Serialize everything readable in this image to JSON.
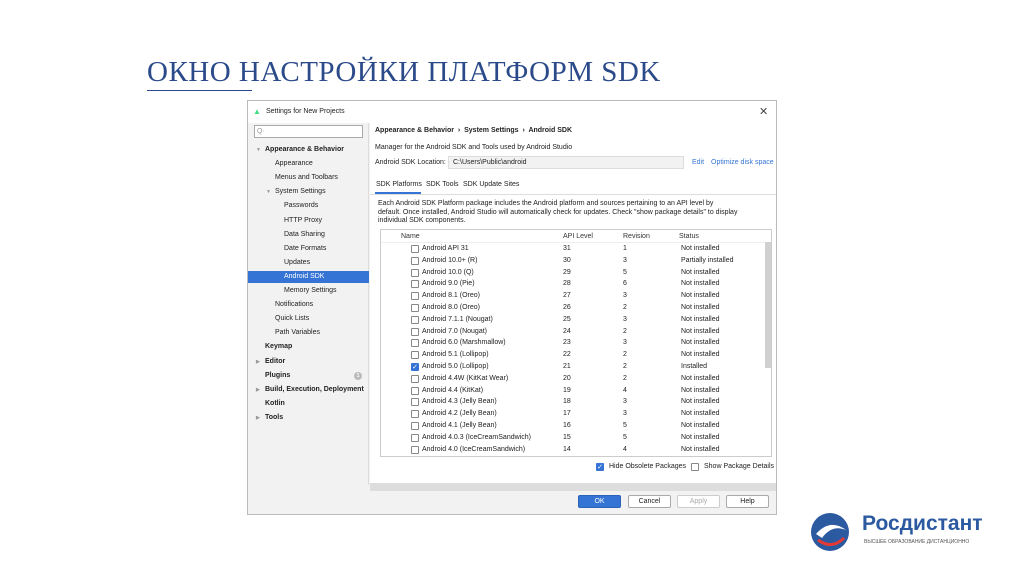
{
  "slide": {
    "title": "ОКНО НАСТРОЙКИ ПЛАТФОРМ SDK"
  },
  "dialog": {
    "title": "Settings for New Projects",
    "search_placeholder": "Q·",
    "sidebar": [
      {
        "label": "Appearance & Behavior",
        "level": 0,
        "bold": true,
        "arrow": "▼"
      },
      {
        "label": "Appearance",
        "level": 1
      },
      {
        "label": "Menus and Toolbars",
        "level": 1
      },
      {
        "label": "System Settings",
        "level": 1,
        "arrow": "▼"
      },
      {
        "label": "Passwords",
        "level": 2
      },
      {
        "label": "HTTP Proxy",
        "level": 2
      },
      {
        "label": "Data Sharing",
        "level": 2
      },
      {
        "label": "Date Formats",
        "level": 2
      },
      {
        "label": "Updates",
        "level": 2
      },
      {
        "label": "Android SDK",
        "level": 2,
        "selected": true
      },
      {
        "label": "Memory Settings",
        "level": 2
      },
      {
        "label": "Notifications",
        "level": 1
      },
      {
        "label": "Quick Lists",
        "level": 1
      },
      {
        "label": "Path Variables",
        "level": 1
      },
      {
        "label": "Keymap",
        "level": 0,
        "bold": true
      },
      {
        "label": "Editor",
        "level": 0,
        "bold": true,
        "arrow": "▶"
      },
      {
        "label": "Plugins",
        "level": 0,
        "bold": true,
        "badge": "1"
      },
      {
        "label": "Build, Execution, Deployment",
        "level": 0,
        "bold": true,
        "arrow": "▶"
      },
      {
        "label": "Kotlin",
        "level": 0,
        "bold": true
      },
      {
        "label": "Tools",
        "level": 0,
        "bold": true,
        "arrow": "▶"
      }
    ],
    "breadcrumb": [
      "Appearance & Behavior",
      "System Settings",
      "Android SDK"
    ],
    "breadcrumb_sep": "›",
    "description": "Manager for the Android SDK and Tools used by Android Studio",
    "location_label": "Android SDK Location:",
    "location_value": "C:\\Users\\Public\\android",
    "edit_link": "Edit",
    "optimize_link": "Optimize disk space",
    "tabs": [
      "SDK Platforms",
      "SDK Tools",
      "SDK Update Sites"
    ],
    "tab_info": "Each Android SDK Platform package includes the Android platform and sources pertaining to an API level by default. Once installed, Android Studio will automatically check for updates. Check \"show package details\" to display individual SDK components.",
    "columns": [
      "Name",
      "API Level",
      "Revision",
      "Status"
    ],
    "rows": [
      {
        "name": "Android API 31",
        "api": "31",
        "rev": "1",
        "status": "Not installed",
        "checked": false
      },
      {
        "name": "Android 10.0+ (R)",
        "api": "30",
        "rev": "3",
        "status": "Partially installed",
        "checked": false
      },
      {
        "name": "Android 10.0 (Q)",
        "api": "29",
        "rev": "5",
        "status": "Not installed",
        "checked": false
      },
      {
        "name": "Android 9.0 (Pie)",
        "api": "28",
        "rev": "6",
        "status": "Not installed",
        "checked": false
      },
      {
        "name": "Android 8.1 (Oreo)",
        "api": "27",
        "rev": "3",
        "status": "Not installed",
        "checked": false
      },
      {
        "name": "Android 8.0 (Oreo)",
        "api": "26",
        "rev": "2",
        "status": "Not installed",
        "checked": false
      },
      {
        "name": "Android 7.1.1 (Nougat)",
        "api": "25",
        "rev": "3",
        "status": "Not installed",
        "checked": false
      },
      {
        "name": "Android 7.0 (Nougat)",
        "api": "24",
        "rev": "2",
        "status": "Not installed",
        "checked": false
      },
      {
        "name": "Android 6.0 (Marshmallow)",
        "api": "23",
        "rev": "3",
        "status": "Not installed",
        "checked": false
      },
      {
        "name": "Android 5.1 (Lollipop)",
        "api": "22",
        "rev": "2",
        "status": "Not installed",
        "checked": false
      },
      {
        "name": "Android 5.0 (Lollipop)",
        "api": "21",
        "rev": "2",
        "status": "Installed",
        "checked": true
      },
      {
        "name": "Android 4.4W (KitKat Wear)",
        "api": "20",
        "rev": "2",
        "status": "Not installed",
        "checked": false
      },
      {
        "name": "Android 4.4 (KitKat)",
        "api": "19",
        "rev": "4",
        "status": "Not installed",
        "checked": false
      },
      {
        "name": "Android 4.3 (Jelly Bean)",
        "api": "18",
        "rev": "3",
        "status": "Not installed",
        "checked": false
      },
      {
        "name": "Android 4.2 (Jelly Bean)",
        "api": "17",
        "rev": "3",
        "status": "Not installed",
        "checked": false
      },
      {
        "name": "Android 4.1 (Jelly Bean)",
        "api": "16",
        "rev": "5",
        "status": "Not installed",
        "checked": false
      },
      {
        "name": "Android 4.0.3 (IceCreamSandwich)",
        "api": "15",
        "rev": "5",
        "status": "Not installed",
        "checked": false
      },
      {
        "name": "Android 4.0 (IceCreamSandwich)",
        "api": "14",
        "rev": "4",
        "status": "Not installed",
        "checked": false
      }
    ],
    "hide_obsolete": "Hide Obsolete Packages",
    "show_details": "Show Package Details",
    "buttons": {
      "ok": "OK",
      "cancel": "Cancel",
      "apply": "Apply",
      "help": "Help"
    }
  },
  "logo": {
    "name": "Росдистант",
    "tagline": "ВЫСШЕЕ ОБРАЗОВАНИЕ ДИСТАНЦИОННО"
  },
  "colors": {
    "accent": "#3574d4",
    "title": "#2b4a8a"
  }
}
